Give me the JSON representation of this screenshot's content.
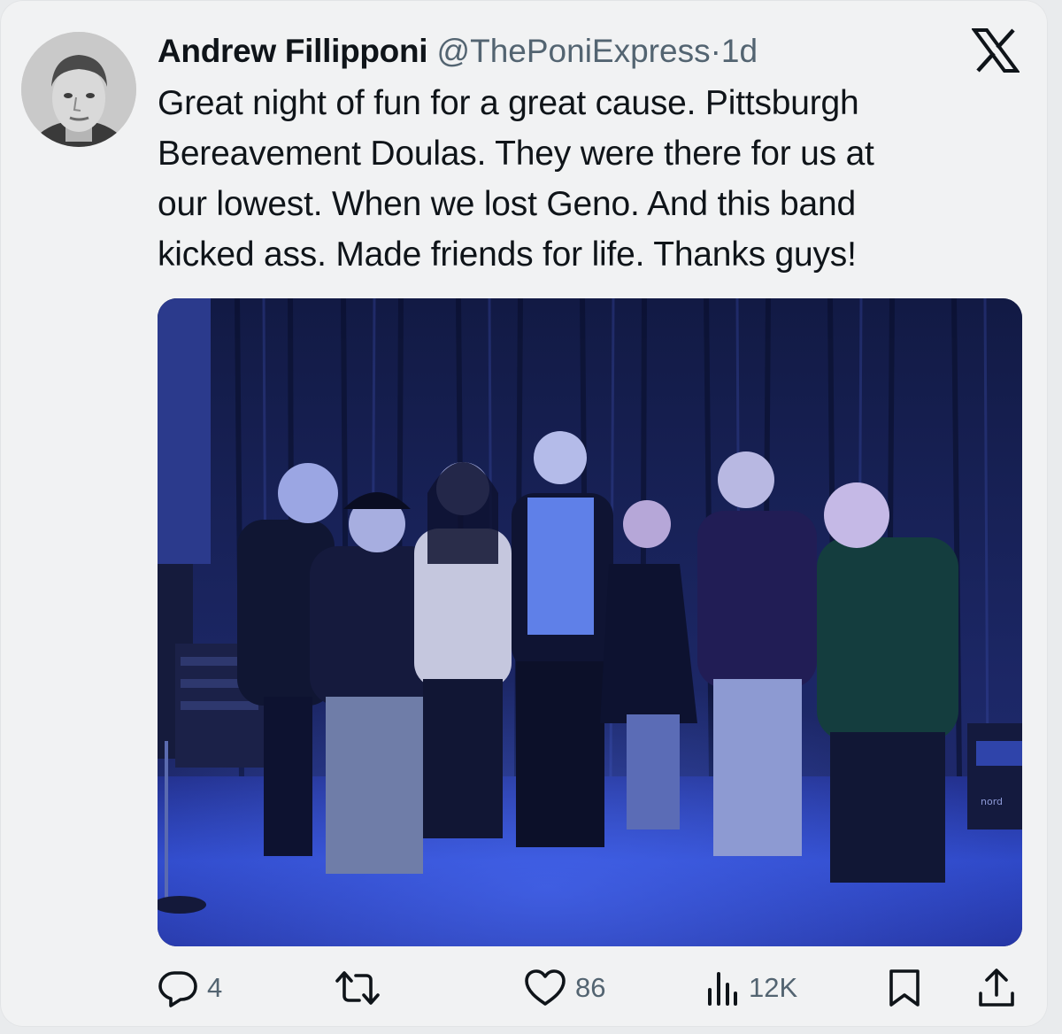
{
  "tweet": {
    "author_name": "Andrew Fillipponi",
    "handle": "@ThePoniExpress",
    "separator": "·",
    "time": "1d",
    "text_lines": [
      "Great night of fun for a great cause. Pittsburgh",
      "Bereavement Doulas. They were there for us at",
      "our lowest. When we lost Geno. And this band",
      "kicked ass. Made friends for life. Thanks guys!"
    ],
    "photo_text": "nord"
  },
  "actions": {
    "replies": "4",
    "reposts": "",
    "likes": "86",
    "views": "12K"
  },
  "icons": {
    "brand": "x-logo-icon",
    "reply": "reply-icon",
    "repost": "repost-icon",
    "like": "heart-icon",
    "views": "views-icon",
    "bookmark": "bookmark-icon",
    "share": "share-icon"
  },
  "colors": {
    "text": "#0f1419",
    "secondary": "#536471",
    "card": "#f1f2f3"
  }
}
